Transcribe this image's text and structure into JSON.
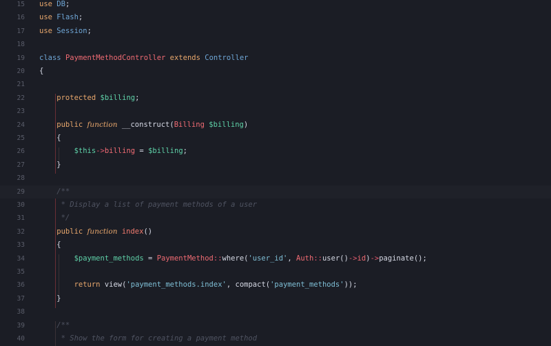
{
  "editor": {
    "language": "php",
    "colors": {
      "background": "#1b1d25",
      "keyword": "#e8a76c",
      "class": "#ef6b73",
      "variable": "#5fd1a8",
      "string": "#7fbfd6",
      "comment": "#4f5361"
    },
    "lines": [
      {
        "num": "15",
        "tokens": [
          {
            "t": "use ",
            "c": "kw"
          },
          {
            "t": "DB",
            "c": "ns"
          },
          {
            "t": ";",
            "c": "pun"
          }
        ]
      },
      {
        "num": "16",
        "tokens": [
          {
            "t": "use ",
            "c": "kw"
          },
          {
            "t": "Flash",
            "c": "ns"
          },
          {
            "t": ";",
            "c": "pun"
          }
        ]
      },
      {
        "num": "17",
        "tokens": [
          {
            "t": "use ",
            "c": "kw"
          },
          {
            "t": "Session",
            "c": "ns"
          },
          {
            "t": ";",
            "c": "pun"
          }
        ]
      },
      {
        "num": "18",
        "tokens": []
      },
      {
        "num": "19",
        "tokens": [
          {
            "t": "class ",
            "c": "ns"
          },
          {
            "t": "PaymentMethodController",
            "c": "cls"
          },
          {
            "t": " extends ",
            "c": "kw"
          },
          {
            "t": "Controller",
            "c": "ns"
          }
        ]
      },
      {
        "num": "20",
        "tokens": [
          {
            "t": "{",
            "c": "pun"
          }
        ]
      },
      {
        "num": "21",
        "tokens": []
      },
      {
        "num": "22",
        "tokens": [
          {
            "t": "    protected ",
            "c": "kw"
          },
          {
            "t": "$billing",
            "c": "var"
          },
          {
            "t": ";",
            "c": "pun"
          }
        ]
      },
      {
        "num": "23",
        "tokens": []
      },
      {
        "num": "24",
        "tokens": [
          {
            "t": "    public ",
            "c": "kw"
          },
          {
            "t": "function",
            "c": "ital"
          },
          {
            "t": " __construct",
            "c": "call"
          },
          {
            "t": "(",
            "c": "pun"
          },
          {
            "t": "Billing ",
            "c": "cls"
          },
          {
            "t": "$billing",
            "c": "var"
          },
          {
            "t": ")",
            "c": "pun"
          }
        ]
      },
      {
        "num": "25",
        "tokens": [
          {
            "t": "    {",
            "c": "pun"
          }
        ]
      },
      {
        "num": "26",
        "tokens": [
          {
            "t": "        $this",
            "c": "var"
          },
          {
            "t": "->",
            "c": "op"
          },
          {
            "t": "billing",
            "c": "prop"
          },
          {
            "t": " = ",
            "c": "pun"
          },
          {
            "t": "$billing",
            "c": "var"
          },
          {
            "t": ";",
            "c": "pun"
          }
        ]
      },
      {
        "num": "27",
        "tokens": [
          {
            "t": "    }",
            "c": "pun"
          }
        ]
      },
      {
        "num": "28",
        "tokens": []
      },
      {
        "num": "29",
        "tokens": [
          {
            "t": "    /**",
            "c": "com"
          }
        ]
      },
      {
        "num": "30",
        "tokens": [
          {
            "t": "     * Display a list of payment methods of a user",
            "c": "com"
          }
        ]
      },
      {
        "num": "31",
        "tokens": [
          {
            "t": "     */",
            "c": "com"
          }
        ]
      },
      {
        "num": "32",
        "tokens": [
          {
            "t": "    public ",
            "c": "kw"
          },
          {
            "t": "function",
            "c": "ital"
          },
          {
            "t": " index",
            "c": "fn"
          },
          {
            "t": "()",
            "c": "pun"
          }
        ]
      },
      {
        "num": "33",
        "tokens": [
          {
            "t": "    {",
            "c": "pun"
          }
        ]
      },
      {
        "num": "34",
        "tokens": [
          {
            "t": "        $payment_methods",
            "c": "var"
          },
          {
            "t": " = ",
            "c": "pun"
          },
          {
            "t": "PaymentMethod",
            "c": "cls"
          },
          {
            "t": "::",
            "c": "op"
          },
          {
            "t": "where",
            "c": "call"
          },
          {
            "t": "(",
            "c": "pun"
          },
          {
            "t": "'user_id'",
            "c": "str"
          },
          {
            "t": ", ",
            "c": "pun"
          },
          {
            "t": "Auth",
            "c": "cls"
          },
          {
            "t": "::",
            "c": "op"
          },
          {
            "t": "user",
            "c": "call"
          },
          {
            "t": "()",
            "c": "pun"
          },
          {
            "t": "->",
            "c": "op"
          },
          {
            "t": "id",
            "c": "prop"
          },
          {
            "t": ")",
            "c": "pun"
          },
          {
            "t": "->",
            "c": "op"
          },
          {
            "t": "paginate",
            "c": "call"
          },
          {
            "t": "();",
            "c": "pun"
          }
        ]
      },
      {
        "num": "35",
        "tokens": []
      },
      {
        "num": "36",
        "tokens": [
          {
            "t": "        return ",
            "c": "kw"
          },
          {
            "t": "view",
            "c": "call"
          },
          {
            "t": "(",
            "c": "pun"
          },
          {
            "t": "'payment_methods.index'",
            "c": "str"
          },
          {
            "t": ", ",
            "c": "pun"
          },
          {
            "t": "compact",
            "c": "call"
          },
          {
            "t": "(",
            "c": "pun"
          },
          {
            "t": "'payment_methods'",
            "c": "str"
          },
          {
            "t": "));",
            "c": "pun"
          }
        ]
      },
      {
        "num": "37",
        "tokens": [
          {
            "t": "    }",
            "c": "pun"
          }
        ]
      },
      {
        "num": "38",
        "tokens": []
      },
      {
        "num": "39",
        "tokens": [
          {
            "t": "    /**",
            "c": "com"
          }
        ]
      },
      {
        "num": "40",
        "tokens": [
          {
            "t": "     * Show the form for creating a payment method",
            "c": "com"
          }
        ]
      }
    ]
  }
}
